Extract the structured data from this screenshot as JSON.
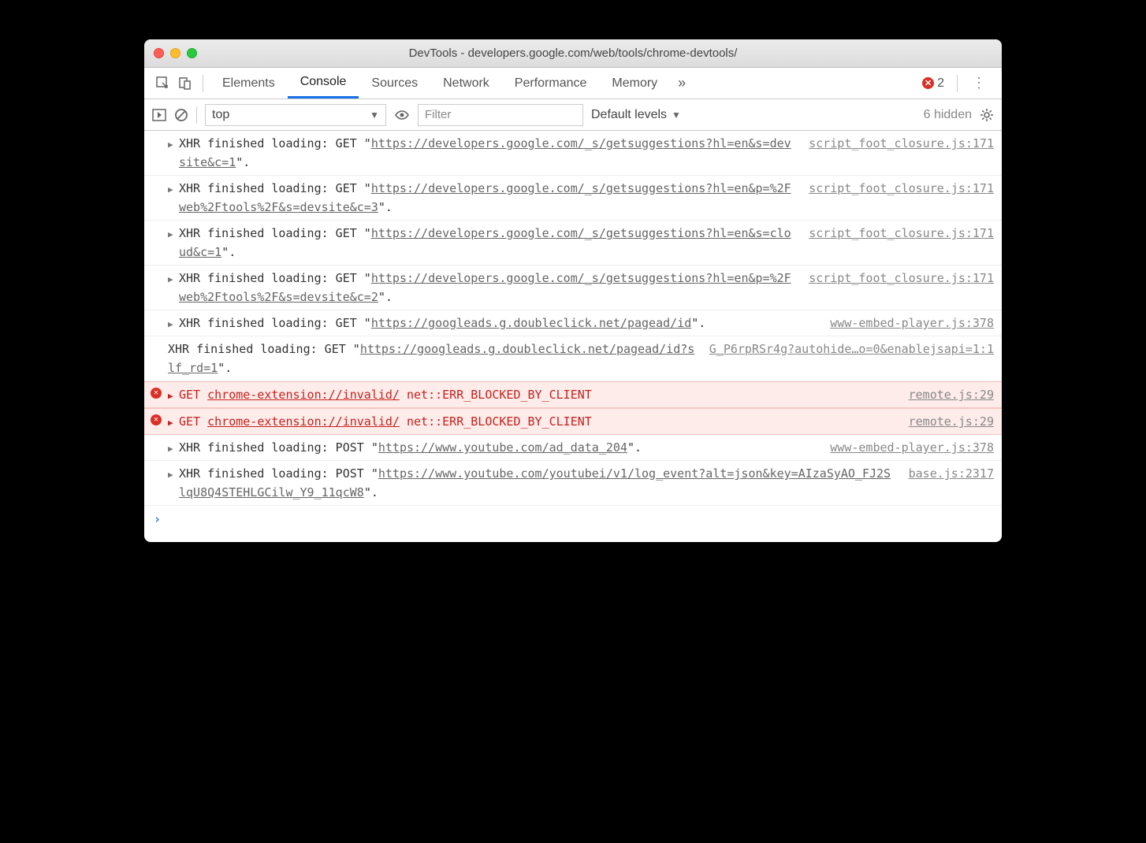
{
  "window": {
    "title": "DevTools - developers.google.com/web/tools/chrome-devtools/"
  },
  "tabs": {
    "items": [
      "Elements",
      "Console",
      "Sources",
      "Network",
      "Performance",
      "Memory"
    ],
    "activeIndex": 1,
    "errorCount": "2"
  },
  "toolbar": {
    "context": "top",
    "filterPlaceholder": "Filter",
    "levels": "Default levels",
    "hidden": "6 hidden"
  },
  "logs": [
    {
      "type": "xhr",
      "method": "GET",
      "prefix": "XHR finished loading: GET \"",
      "url": "https://developers.google.com/_s/getsuggestions?hl=en&s=devsite&c=1",
      "suffix": "\".",
      "source": "script_foot_closure.js:171",
      "arrow": true
    },
    {
      "type": "xhr",
      "method": "GET",
      "prefix": "XHR finished loading: GET \"",
      "url": "https://developers.google.com/_s/getsuggestions?hl=en&p=%2Fweb%2Ftools%2F&s=devsite&c=3",
      "suffix": "\".",
      "source": "script_foot_closure.js:171",
      "arrow": true
    },
    {
      "type": "xhr",
      "method": "GET",
      "prefix": "XHR finished loading: GET \"",
      "url": "https://developers.google.com/_s/getsuggestions?hl=en&s=cloud&c=1",
      "suffix": "\".",
      "source": "script_foot_closure.js:171",
      "arrow": true
    },
    {
      "type": "xhr",
      "method": "GET",
      "prefix": "XHR finished loading: GET \"",
      "url": "https://developers.google.com/_s/getsuggestions?hl=en&p=%2Fweb%2Ftools%2F&s=devsite&c=2",
      "suffix": "\".",
      "source": "script_foot_closure.js:171",
      "arrow": true
    },
    {
      "type": "xhr",
      "method": "GET",
      "prefix": "XHR finished loading: GET \"",
      "url": "https://googleads.g.doubleclick.net/pagead/id",
      "suffix": "\".",
      "source": "www-embed-player.js:378",
      "arrow": true
    },
    {
      "type": "xhr",
      "method": "GET",
      "prefix": "XHR finished loading: GET \"",
      "url": "https://googleads.g.doubleclick.net/pagead/id?slf_rd=1",
      "suffix": "\".",
      "source": "G_P6rpRSr4g?autohide…o=0&enablejsapi=1:1",
      "arrow": false
    },
    {
      "type": "error",
      "method": "GET",
      "url": "chrome-extension://invalid/",
      "errorText": "net::ERR_BLOCKED_BY_CLIENT",
      "source": "remote.js:29",
      "arrow": true
    },
    {
      "type": "error",
      "method": "GET",
      "url": "chrome-extension://invalid/",
      "errorText": "net::ERR_BLOCKED_BY_CLIENT",
      "source": "remote.js:29",
      "arrow": true
    },
    {
      "type": "xhr",
      "method": "POST",
      "prefix": "XHR finished loading: POST \"",
      "url": "https://www.youtube.com/ad_data_204",
      "suffix": "\".",
      "source": "www-embed-player.js:378",
      "arrow": true
    },
    {
      "type": "xhr",
      "method": "POST",
      "prefix": "XHR finished loading: POST \"",
      "url": "https://www.youtube.com/youtubei/v1/log_event?alt=json&key=AIzaSyAO_FJ2SlqU8Q4STEHLGCilw_Y9_11qcW8",
      "suffix": "\".",
      "source": "base.js:2317",
      "arrow": true
    }
  ]
}
